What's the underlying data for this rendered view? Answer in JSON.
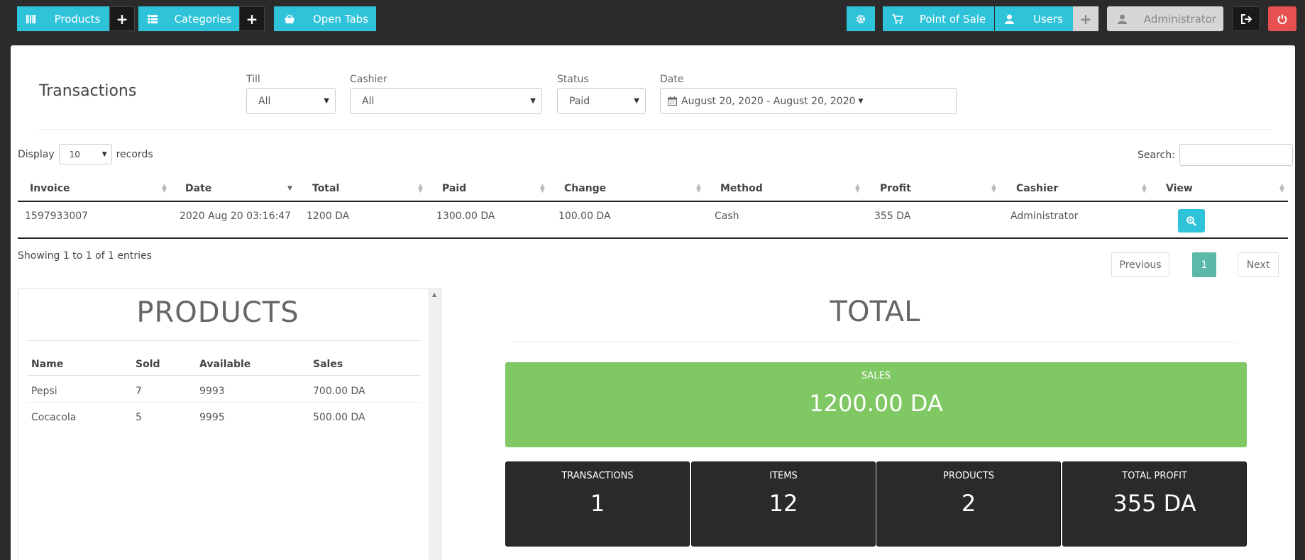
{
  "topbar": {
    "products_label": "Products",
    "categories_label": "Categories",
    "open_tabs_label": "Open Tabs",
    "pos_label": "Point of Sale",
    "users_label": "Users",
    "admin_label": "Administrator",
    "plus": "+"
  },
  "transactions": {
    "title": "Transactions",
    "filters": {
      "till_label": "Till",
      "till_value": "All",
      "cashier_label": "Cashier",
      "cashier_value": "All",
      "status_label": "Status",
      "status_value": "Paid",
      "date_label": "Date",
      "date_value": "August 20, 2020 - August 20, 2020"
    },
    "display_prefix": "Display",
    "display_value": "10",
    "display_suffix": "records",
    "search_label": "Search:",
    "columns": [
      "Invoice",
      "Date",
      "Total",
      "Paid",
      "Change",
      "Method",
      "Profit",
      "Cashier",
      "View"
    ],
    "rows": [
      {
        "invoice": "1597933007",
        "date": "2020 Aug 20 03:16:47",
        "total": "1200 DA",
        "paid": "1300.00 DA",
        "change": "100.00 DA",
        "method": "Cash",
        "profit": "355 DA",
        "cashier": "Administrator"
      }
    ],
    "showing": "Showing 1 to 1 of 1 entries",
    "pagination": {
      "previous": "Previous",
      "current": "1",
      "next": "Next"
    }
  },
  "products": {
    "title": "PRODUCTS",
    "columns": [
      "Name",
      "Sold",
      "Available",
      "Sales"
    ],
    "rows": [
      {
        "name": "Pepsi",
        "sold": "7",
        "available": "9993",
        "sales": "700.00 DA"
      },
      {
        "name": "Cocacola",
        "sold": "5",
        "available": "9995",
        "sales": "500.00 DA"
      }
    ]
  },
  "total": {
    "title": "TOTAL",
    "sales_caption": "SALES",
    "sales_value": "1200.00 DA",
    "cards": [
      {
        "caption": "TRANSACTIONS",
        "value": "1"
      },
      {
        "caption": "ITEMS",
        "value": "12"
      },
      {
        "caption": "PRODUCTS",
        "value": "2"
      },
      {
        "caption": "TOTAL PROFIT",
        "value": "355 DA"
      }
    ]
  },
  "colors": {
    "accent": "#2fc3d9",
    "sales_green": "#80c864",
    "card_dark": "#2a2a2a",
    "logout_red": "#e65050",
    "page_active": "#5cb8a8"
  }
}
